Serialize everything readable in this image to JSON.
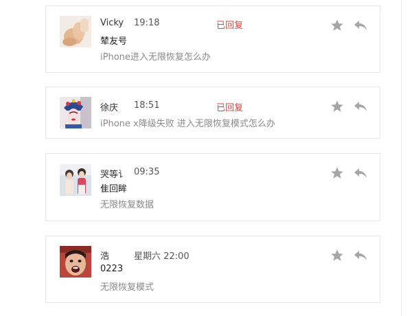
{
  "messages": [
    {
      "sender": "Vicky",
      "time": "19:18",
      "status": "已回复",
      "subject": "辇友号",
      "preview": "iPhone进入无限恢复怎么办"
    },
    {
      "sender": "徐庆",
      "time": "18:51",
      "status": "已回复",
      "subject": "",
      "preview": "iPhone x降级失败 进入无限恢复模式怎么办"
    },
    {
      "sender": "哭等讠",
      "time": "09:35",
      "status": "",
      "subject": "隹回眸",
      "preview": "无限恢复数据"
    },
    {
      "sender": "浩",
      "time": "星期六 22:00",
      "status": "",
      "subject": "0223",
      "preview": "无限恢复模式"
    }
  ],
  "icons": {
    "star": "star-icon",
    "reply": "reply-arrow-icon"
  },
  "colors": {
    "status_red": "#d64541",
    "icon_gray": "#a6a6a6",
    "border": "#e6e6e6"
  }
}
